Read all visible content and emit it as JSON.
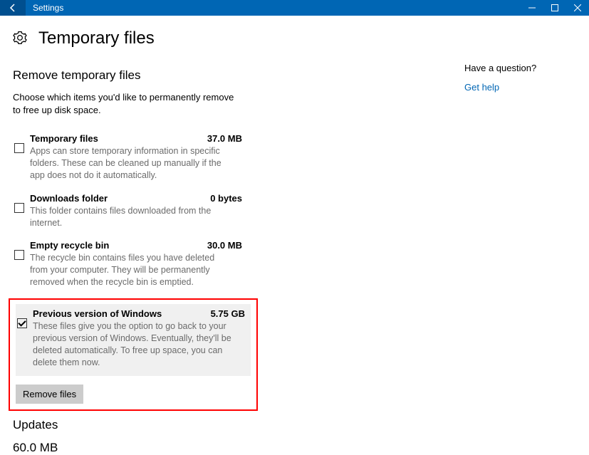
{
  "window": {
    "title": "Settings"
  },
  "header": {
    "title": "Temporary files"
  },
  "section": {
    "heading": "Remove temporary files",
    "instruction": "Choose which items you'd like to permanently remove to free up disk space."
  },
  "items": [
    {
      "name": "Temporary files",
      "size": "37.0 MB",
      "desc": "Apps can store temporary information in specific folders. These can be cleaned up manually if the app does not do it automatically.",
      "checked": false
    },
    {
      "name": "Downloads folder",
      "size": "0 bytes",
      "desc": "This folder contains files downloaded from the internet.",
      "checked": false
    },
    {
      "name": "Empty recycle bin",
      "size": "30.0 MB",
      "desc": "The recycle bin contains files you have deleted from your computer. They will be permanently removed when the recycle bin is emptied.",
      "checked": false
    },
    {
      "name": "Previous version of Windows",
      "size": "5.75 GB",
      "desc": "These files give you the option to go back to your previous version of Windows. Eventually, they'll be deleted automatically. To free up space, you can delete them now.",
      "checked": true
    }
  ],
  "remove_button": "Remove files",
  "updates": {
    "heading": "Updates",
    "size": "60.0 MB"
  },
  "sidebar": {
    "question": "Have a question?",
    "help": "Get help"
  }
}
